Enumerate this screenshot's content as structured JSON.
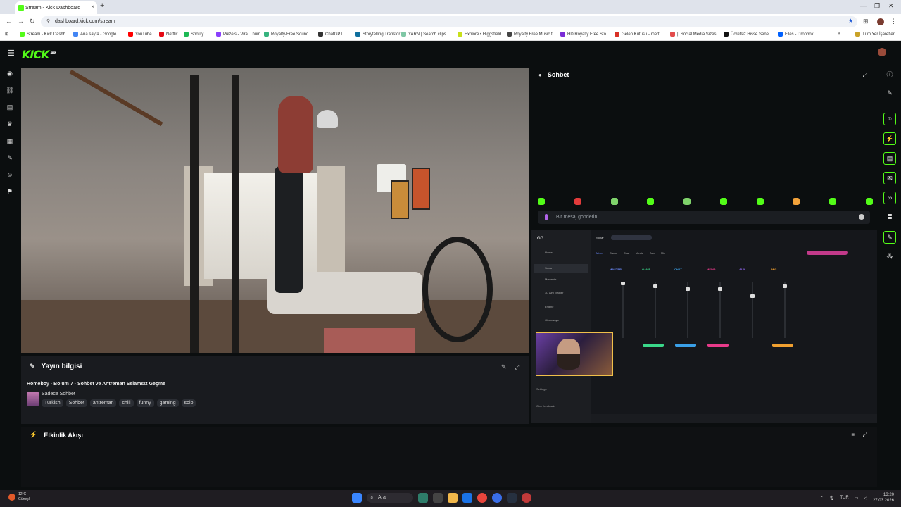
{
  "browser": {
    "tab_title": "Stream - Kick Dashboard",
    "url": "dashboard.kick.com/stream",
    "bookmarks": [
      {
        "label": "Stream - Kick Dashb...",
        "color": "#53fc18"
      },
      {
        "label": "Ana sayfa - Google...",
        "color": "#4285f4"
      },
      {
        "label": "YouTube",
        "color": "#ff0000"
      },
      {
        "label": "Netflix",
        "color": "#e50914"
      },
      {
        "label": "Spotify",
        "color": "#1db954"
      },
      {
        "label": "Pikzels - Viral Thum...",
        "color": "#8a3ffc"
      },
      {
        "label": "Royalty-Free Sound...",
        "color": "#36b37e"
      },
      {
        "label": "ChatGPT",
        "color": "#333333"
      },
      {
        "label": "Storytelling Transfor...",
        "color": "#0f6f9e"
      },
      {
        "label": "YARN | Search clips...",
        "color": "#7fc7a5"
      },
      {
        "label": "Explore • Higgsfield",
        "color": "#c8e01a"
      },
      {
        "label": "Royalty Free Music f...",
        "color": "#444444"
      },
      {
        "label": "HD Royalty Free Sto...",
        "color": "#7a2bd6"
      },
      {
        "label": "Gelen Kutusu - mert...",
        "color": "#d93025"
      },
      {
        "label": "|| Social Media Sizes...",
        "color": "#e34b4b"
      },
      {
        "label": "Ücretsiz Hisse Sene...",
        "color": "#111111"
      },
      {
        "label": "Files - Dropbox",
        "color": "#0061ff"
      }
    ],
    "all_bookmarks_label": "Tüm Yer İşaretleri"
  },
  "kick": {
    "logo": "KICK",
    "logo_badge": "BETA"
  },
  "stream_info": {
    "header": "Yayın bilgisi",
    "title": "Homeboy - Bölüm 7 - Sohbet ve Antreman Selamsız Geçme",
    "category": "Sadece Sohbet",
    "tags": [
      "Turkish",
      "Sohbet",
      "antreman",
      "chill",
      "funny",
      "gaming",
      "solo"
    ]
  },
  "activity": {
    "header": "Etkinlik Akışı"
  },
  "chat": {
    "header": "Sohbet",
    "input_placeholder": "Bir mesaj gönderin",
    "emote_colors": [
      "#53fc18",
      "#e23b3b",
      "#7fd36b",
      "#53fc18",
      "#7fd36b",
      "#53fc18",
      "#53fc18",
      "#f2a23a",
      "#53fc18",
      "#53fc18"
    ]
  },
  "share": {
    "app": "GG",
    "nav": [
      "Home",
      "Sonar",
      "Moments",
      "3D Aim Trainer",
      "Engine",
      "Giveaways"
    ],
    "settings": "Settings",
    "feedback": "Give feedback",
    "sonar_title": "Sonar",
    "tabs": [
      "Mixer",
      "Game",
      "Chat",
      "Media",
      "Aux",
      "Mic"
    ],
    "mixers": [
      {
        "name": "MASTER",
        "color": "#6c8cff"
      },
      {
        "name": "GAME",
        "color": "#3ad88a"
      },
      {
        "name": "CHAT",
        "color": "#3aa0e8"
      },
      {
        "name": "MEDIA",
        "color": "#e83a8a"
      },
      {
        "name": "AUX",
        "color": "#9a6cff"
      },
      {
        "name": "MIC",
        "color": "#f0a030"
      }
    ]
  },
  "taskbar": {
    "temp": "12°C",
    "weather": "Güneşli",
    "search": "Ara",
    "lang": "TUR",
    "time": "13:20",
    "date": "27.03.2026"
  }
}
